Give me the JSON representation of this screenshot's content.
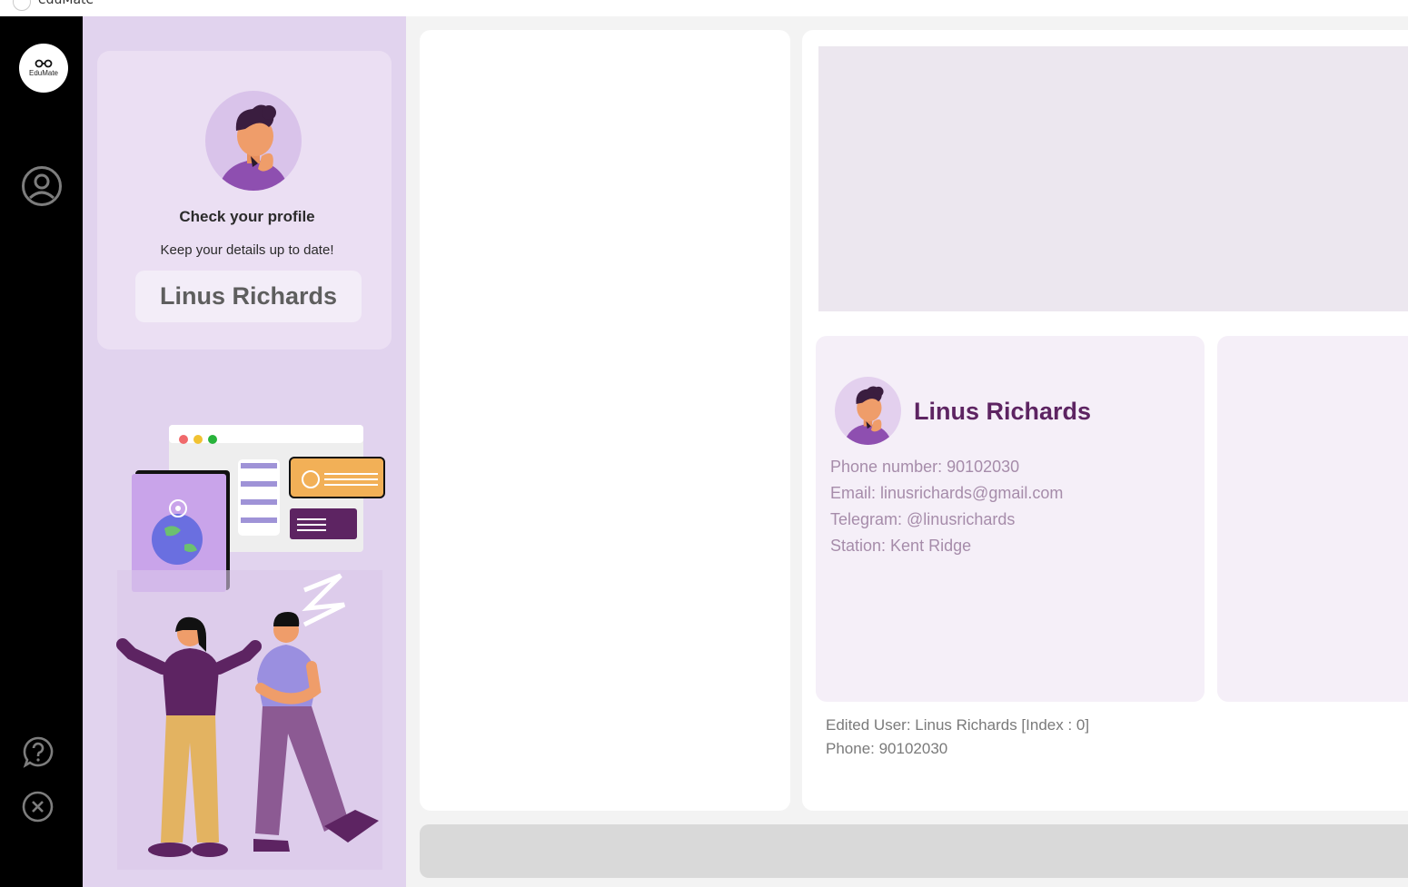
{
  "window": {
    "title": "eduMate"
  },
  "rail": {
    "logo_text": "EduMate",
    "profile_icon": "user-circle-icon",
    "help_icon": "help-bubble-icon",
    "close_icon": "close-circle-icon"
  },
  "profile_card": {
    "heading": "Check your profile",
    "subtitle": "Keep your details up to date!",
    "name": "Linus Richards"
  },
  "contact_card": {
    "name": "Linus Richards",
    "phone": "Phone number: 90102030",
    "email": "Email: linusrichards@gmail.com",
    "telegram": "Telegram: @linusrichards",
    "station": "Station: Kent Ridge"
  },
  "result": {
    "line1": "Edited User: Linus Richards [Index : 0]",
    "line2": "Phone: 90102030"
  },
  "colors": {
    "rail": "#000000",
    "left_panel": "#e1d3ee",
    "accent_name": "#5d2462",
    "field_text": "#a68caa"
  }
}
